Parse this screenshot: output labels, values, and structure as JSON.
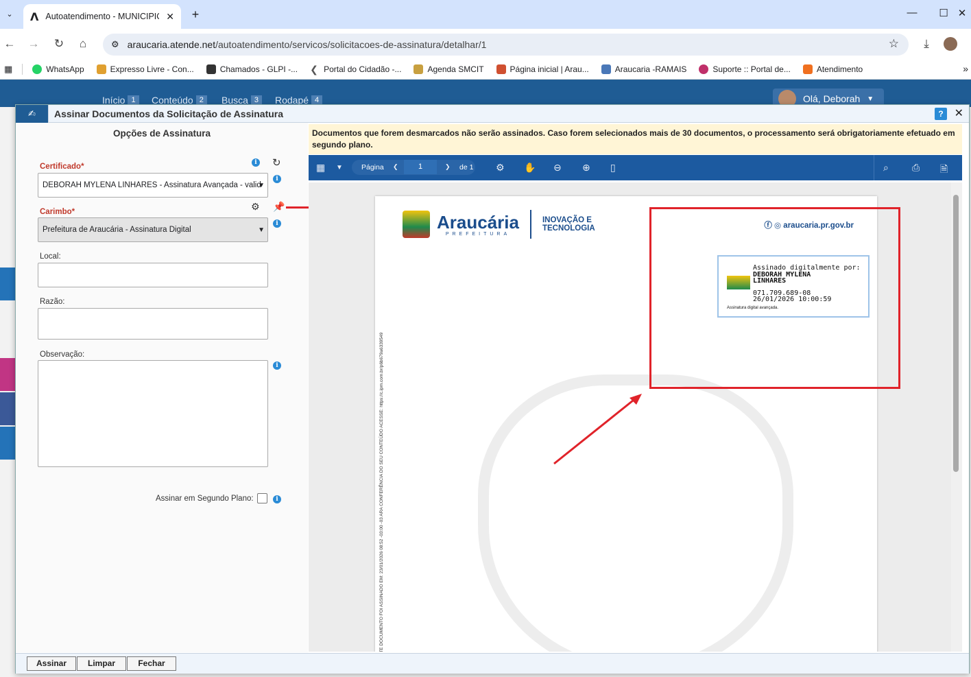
{
  "browser": {
    "tab_title": "Autoatendimento - MUNICIPIO",
    "tab_logo": "Λ",
    "url_host": "araucaria.atende.net",
    "url_path": "/autoatendimento/servicos/solicitacoes-de-assinatura/detalhar/1",
    "bookmarks": [
      {
        "label": "WhatsApp",
        "color": "#25d366"
      },
      {
        "label": "Expresso Livre - Con...",
        "color": "#e0a030"
      },
      {
        "label": "Chamados - GLPI -...",
        "color": "#333333"
      },
      {
        "label": "Portal do Cidadão -...",
        "color": "#555555"
      },
      {
        "label": "Agenda SMCIT",
        "color": "#c8a040"
      },
      {
        "label": "Página inicial | Arau...",
        "color": "#d05030"
      },
      {
        "label": "Araucaria -RAMAIS",
        "color": "#4a78b8"
      },
      {
        "label": "Suporte :: Portal de...",
        "color": "#c0306a"
      },
      {
        "label": "Atendimento",
        "color": "#f07020"
      }
    ]
  },
  "site": {
    "skip_links": [
      {
        "label": "Início",
        "num": "1"
      },
      {
        "label": "Conteúdo",
        "num": "2"
      },
      {
        "label": "Busca",
        "num": "3"
      },
      {
        "label": "Rodapé",
        "num": "4"
      }
    ],
    "greeting": "Olá, Deborah"
  },
  "modal": {
    "title": "Assinar Documentos da Solicitação de Assinatura",
    "help": "?",
    "close": "✕",
    "options_title": "Opções de Assinatura",
    "certificado_label": "Certificado*",
    "certificado_value": "DEBORAH MYLENA LINHARES - Assinatura Avançada - valid",
    "carimbo_label": "Carimbo*",
    "carimbo_value": "Prefeitura de Araucária - Assinatura Digital",
    "local_label": "Local:",
    "razao_label": "Razão:",
    "observacao_label": "Observação:",
    "segundo_plano_label": "Assinar em Segundo Plano:",
    "notice": "Documentos que forem desmarcados não serão assinados. Caso forem selecionados mais de 30 documentos, o processamento será obrigatoriamente efetuado em segundo plano.",
    "viewer": {
      "page_label": "Página",
      "page_current": "1",
      "page_of": "de 1"
    },
    "document": {
      "brand_name": "Araucária",
      "brand_sub": "PREFEITURA",
      "tech_line1": "INOVAÇÃO E",
      "tech_line2": "TECNOLOGIA",
      "site": "araucaria.pr.gov.br",
      "stamp_line1": "Assinado digitalmente por:",
      "stamp_line2": "DEBORAH MYLENA LINHARES",
      "stamp_line3": "071.709.689-08",
      "stamp_line4": "26/01/2026 10:00:59",
      "stamp_line5": "Assinatura digital avançada.",
      "side_text": "STE DOCUMENTO FOI ASSINADO EM: 23/01/2026 08:52 -03:00 -03 ARA CONFERÊNCIA DO SEU CONTEÚDO ACESSE: https://c.ipm.com.br/p6b679a6339549"
    },
    "buttons": {
      "assinar": "Assinar",
      "limpar": "Limpar",
      "fechar": "Fechar"
    }
  }
}
